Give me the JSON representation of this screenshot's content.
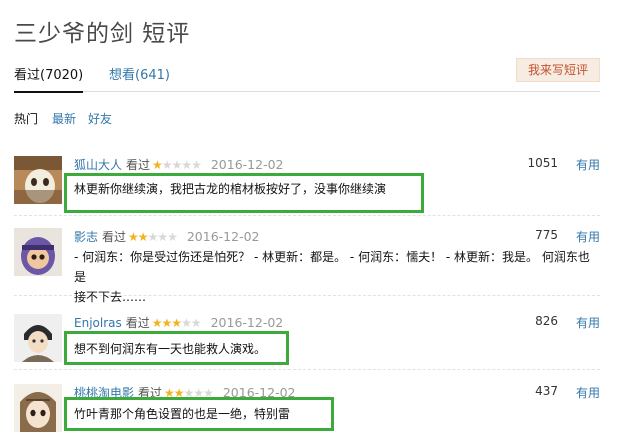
{
  "page": {
    "title": "三少爷的剑 短评",
    "write_button": "我来写短评"
  },
  "tabs": [
    {
      "label": "看过(7020)",
      "active": true
    },
    {
      "label": "想看(641)",
      "active": false
    }
  ],
  "filters": [
    "热门",
    "最新",
    "好友"
  ],
  "status_word": "看过",
  "useful_label": "有用",
  "colors": {
    "link": "#3377aa",
    "star": "#f2b31f",
    "highlight_box": "#3cab3c",
    "button_text": "#c4512e"
  },
  "reviews": [
    {
      "user": "狐山大人",
      "rating": 1,
      "date": "2016-12-02",
      "votes": "1051",
      "comment_lines": [
        "林更新你继续演，我把古龙的棺材板按好了，没事你继续演"
      ],
      "avatar_icon": "cartoon-face-avatar-icon",
      "highlighted": true
    },
    {
      "user": "影志",
      "rating": 2,
      "date": "2016-12-02",
      "votes": "775",
      "comment_lines": [
        "- 何润东：你是受过伤还是怕死？ - 林更新：都是。 - 何润东：懦夫！ - 林更新：我是。 何润东也是",
        "接不下去……"
      ],
      "avatar_icon": "ninja-character-avatar-icon",
      "highlighted": false
    },
    {
      "user": "Enjolras",
      "rating": 3,
      "date": "2016-12-02",
      "votes": "826",
      "comment_lines": [
        "想不到何润东有一天也能救人演戏。"
      ],
      "avatar_icon": "sketch-character-avatar-icon",
      "highlighted": true
    },
    {
      "user": "桃桃淘电影",
      "rating": 2,
      "date": "2016-12-02",
      "votes": "437",
      "comment_lines": [
        "竹叶青那个角色设置的也是一绝，特别雷"
      ],
      "avatar_icon": "anime-girl-avatar-icon",
      "highlighted": true
    }
  ]
}
